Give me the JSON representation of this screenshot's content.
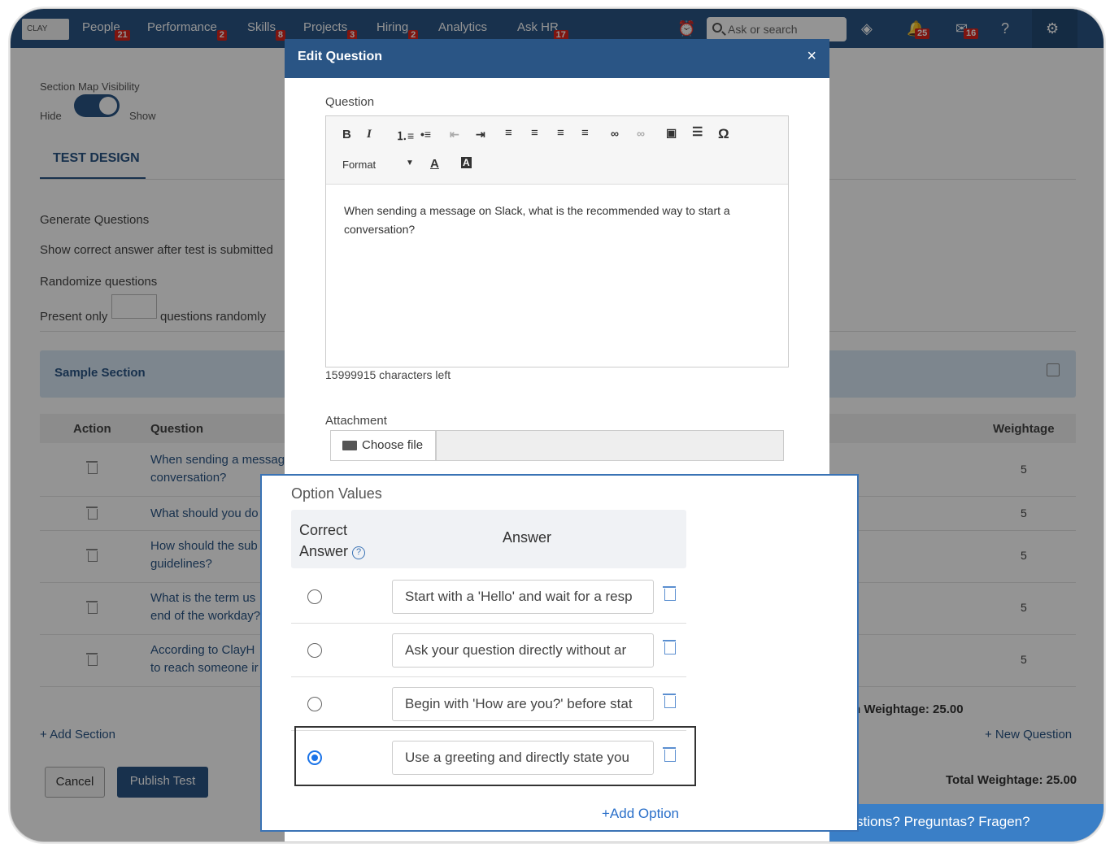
{
  "topbar": {
    "logo": "CLAY",
    "nav": [
      {
        "label": "People",
        "badge": "21"
      },
      {
        "label": "Performance",
        "badge": "2"
      },
      {
        "label": "Skills",
        "badge": "8"
      },
      {
        "label": "Projects",
        "badge": "3"
      },
      {
        "label": "Hiring",
        "badge": "2"
      },
      {
        "label": "Analytics",
        "badge": ""
      },
      {
        "label": "Ask HR",
        "badge": "17"
      }
    ],
    "search_placeholder": "Ask or search",
    "bell_badge": "25",
    "mail_badge": "16"
  },
  "page": {
    "section_map_visibility": "Section Map Visibility",
    "hide": "Hide",
    "show": "Show",
    "tab": "TEST DESIGN",
    "generate_questions": "Generate Questions",
    "show_correct": "Show correct answer after test is submitted",
    "randomize": "Randomize questions",
    "present_only": "Present only",
    "questions_randomly": "questions randomly",
    "section_title": "Sample Section",
    "col_action": "Action",
    "col_question": "Question",
    "col_weightage": "Weightage",
    "rows": [
      {
        "q1": "When sending a message",
        "q2": "conversation?",
        "w": "5"
      },
      {
        "q1": "What should you do",
        "q2": "",
        "w": "5"
      },
      {
        "q1": "How should the sub",
        "q2": "guidelines?",
        "w": "5"
      },
      {
        "q1": "What is the term us",
        "q2": "end of the workday?",
        "w": "5"
      },
      {
        "q1": "According to ClayH",
        "q2": "to reach someone ir",
        "w": "5"
      }
    ],
    "section_weightage": "n Weightage: 25.00",
    "add_section": "+ Add Section",
    "new_question": "+ New Question",
    "total_weightage": "Total Weightage: 25.00",
    "cancel": "Cancel",
    "publish": "Publish Test",
    "chat": "stions? Preguntas? Fragen?"
  },
  "modal": {
    "title": "Edit Question",
    "close": "×",
    "question_label": "Question",
    "format": "Format",
    "question_text": "When sending a message on Slack, what is the recommended way to start a conversation?",
    "chars_left": "15999915 characters left",
    "attachment": "Attachment",
    "choose_file": "Choose file"
  },
  "options": {
    "title": "Option Values",
    "correct_answer_1": "Correct",
    "correct_answer_2": "Answer",
    "answer_header": "Answer",
    "items": [
      {
        "text": "Start with a 'Hello' and wait for a resp",
        "correct": false
      },
      {
        "text": "Ask your question directly without ar",
        "correct": false
      },
      {
        "text": "Begin with 'How are you?' before stat",
        "correct": false
      },
      {
        "text": "Use a greeting and directly state you",
        "correct": true
      }
    ],
    "add_option": "+Add Option"
  }
}
